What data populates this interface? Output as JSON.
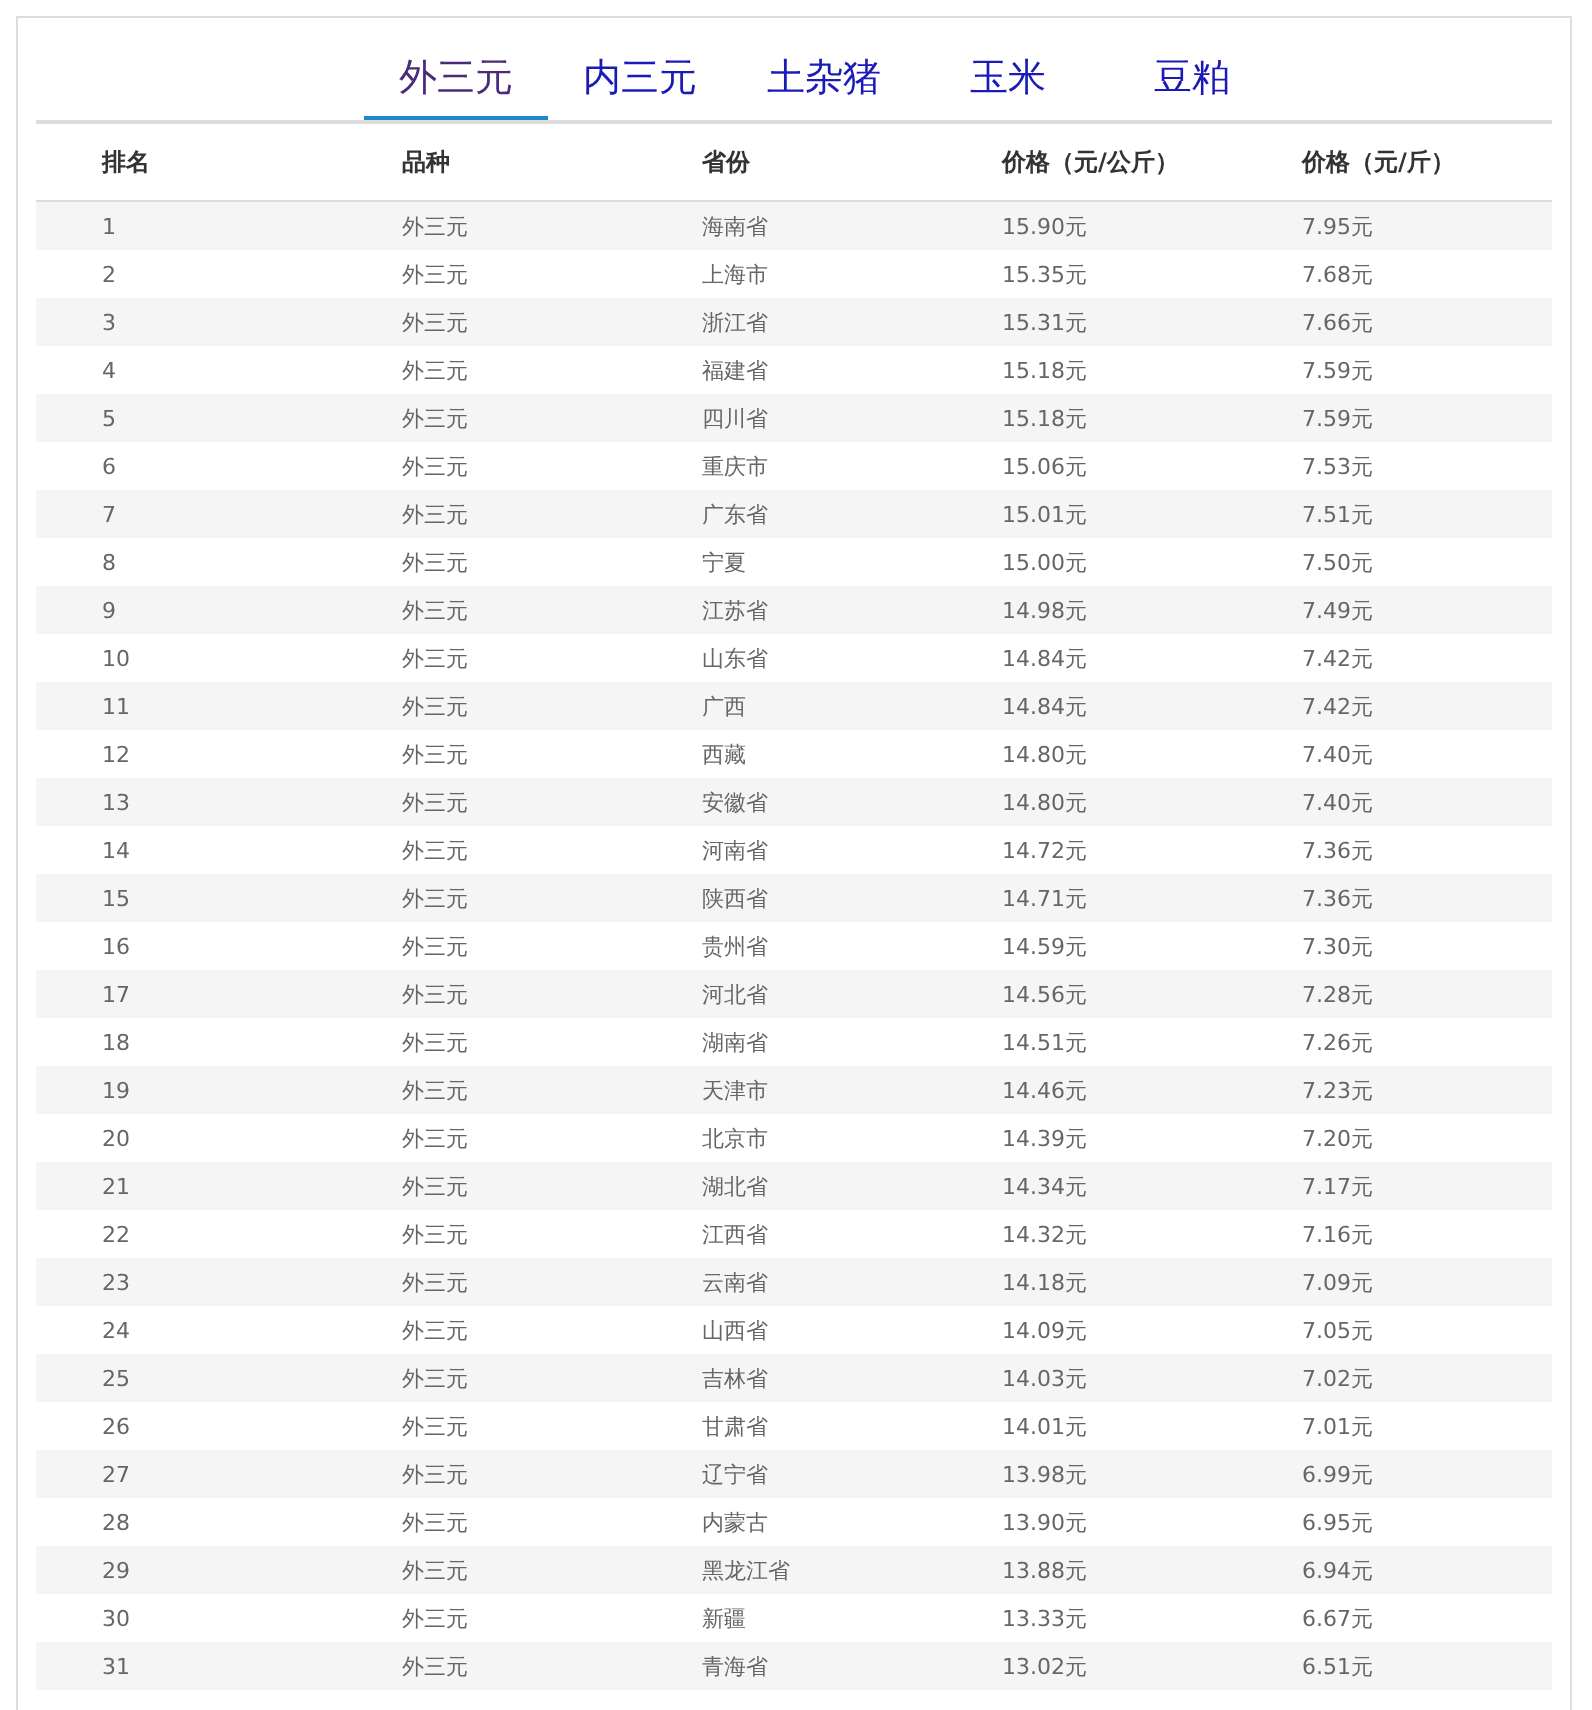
{
  "tabs": [
    {
      "label": "外三元",
      "selected": true
    },
    {
      "label": "内三元",
      "selected": false
    },
    {
      "label": "土杂猪",
      "selected": false
    },
    {
      "label": "玉米",
      "selected": false
    },
    {
      "label": "豆粕",
      "selected": false
    }
  ],
  "table": {
    "columns": [
      "排名",
      "品种",
      "省份",
      "价格（元/公斤）",
      "价格（元/斤）"
    ],
    "rows": [
      [
        "1",
        "外三元",
        "海南省",
        "15.90元",
        "7.95元"
      ],
      [
        "2",
        "外三元",
        "上海市",
        "15.35元",
        "7.68元"
      ],
      [
        "3",
        "外三元",
        "浙江省",
        "15.31元",
        "7.66元"
      ],
      [
        "4",
        "外三元",
        "福建省",
        "15.18元",
        "7.59元"
      ],
      [
        "5",
        "外三元",
        "四川省",
        "15.18元",
        "7.59元"
      ],
      [
        "6",
        "外三元",
        "重庆市",
        "15.06元",
        "7.53元"
      ],
      [
        "7",
        "外三元",
        "广东省",
        "15.01元",
        "7.51元"
      ],
      [
        "8",
        "外三元",
        "宁夏",
        "15.00元",
        "7.50元"
      ],
      [
        "9",
        "外三元",
        "江苏省",
        "14.98元",
        "7.49元"
      ],
      [
        "10",
        "外三元",
        "山东省",
        "14.84元",
        "7.42元"
      ],
      [
        "11",
        "外三元",
        "广西",
        "14.84元",
        "7.42元"
      ],
      [
        "12",
        "外三元",
        "西藏",
        "14.80元",
        "7.40元"
      ],
      [
        "13",
        "外三元",
        "安徽省",
        "14.80元",
        "7.40元"
      ],
      [
        "14",
        "外三元",
        "河南省",
        "14.72元",
        "7.36元"
      ],
      [
        "15",
        "外三元",
        "陕西省",
        "14.71元",
        "7.36元"
      ],
      [
        "16",
        "外三元",
        "贵州省",
        "14.59元",
        "7.30元"
      ],
      [
        "17",
        "外三元",
        "河北省",
        "14.56元",
        "7.28元"
      ],
      [
        "18",
        "外三元",
        "湖南省",
        "14.51元",
        "7.26元"
      ],
      [
        "19",
        "外三元",
        "天津市",
        "14.46元",
        "7.23元"
      ],
      [
        "20",
        "外三元",
        "北京市",
        "14.39元",
        "7.20元"
      ],
      [
        "21",
        "外三元",
        "湖北省",
        "14.34元",
        "7.17元"
      ],
      [
        "22",
        "外三元",
        "江西省",
        "14.32元",
        "7.16元"
      ],
      [
        "23",
        "外三元",
        "云南省",
        "14.18元",
        "7.09元"
      ],
      [
        "24",
        "外三元",
        "山西省",
        "14.09元",
        "7.05元"
      ],
      [
        "25",
        "外三元",
        "吉林省",
        "14.03元",
        "7.02元"
      ],
      [
        "26",
        "外三元",
        "甘肃省",
        "14.01元",
        "7.01元"
      ],
      [
        "27",
        "外三元",
        "辽宁省",
        "13.98元",
        "6.99元"
      ],
      [
        "28",
        "外三元",
        "内蒙古",
        "13.90元",
        "6.95元"
      ],
      [
        "29",
        "外三元",
        "黑龙江省",
        "13.88元",
        "6.94元"
      ],
      [
        "30",
        "外三元",
        "新疆",
        "13.33元",
        "6.67元"
      ],
      [
        "31",
        "外三元",
        "青海省",
        "13.02元",
        "6.51元"
      ]
    ]
  }
}
